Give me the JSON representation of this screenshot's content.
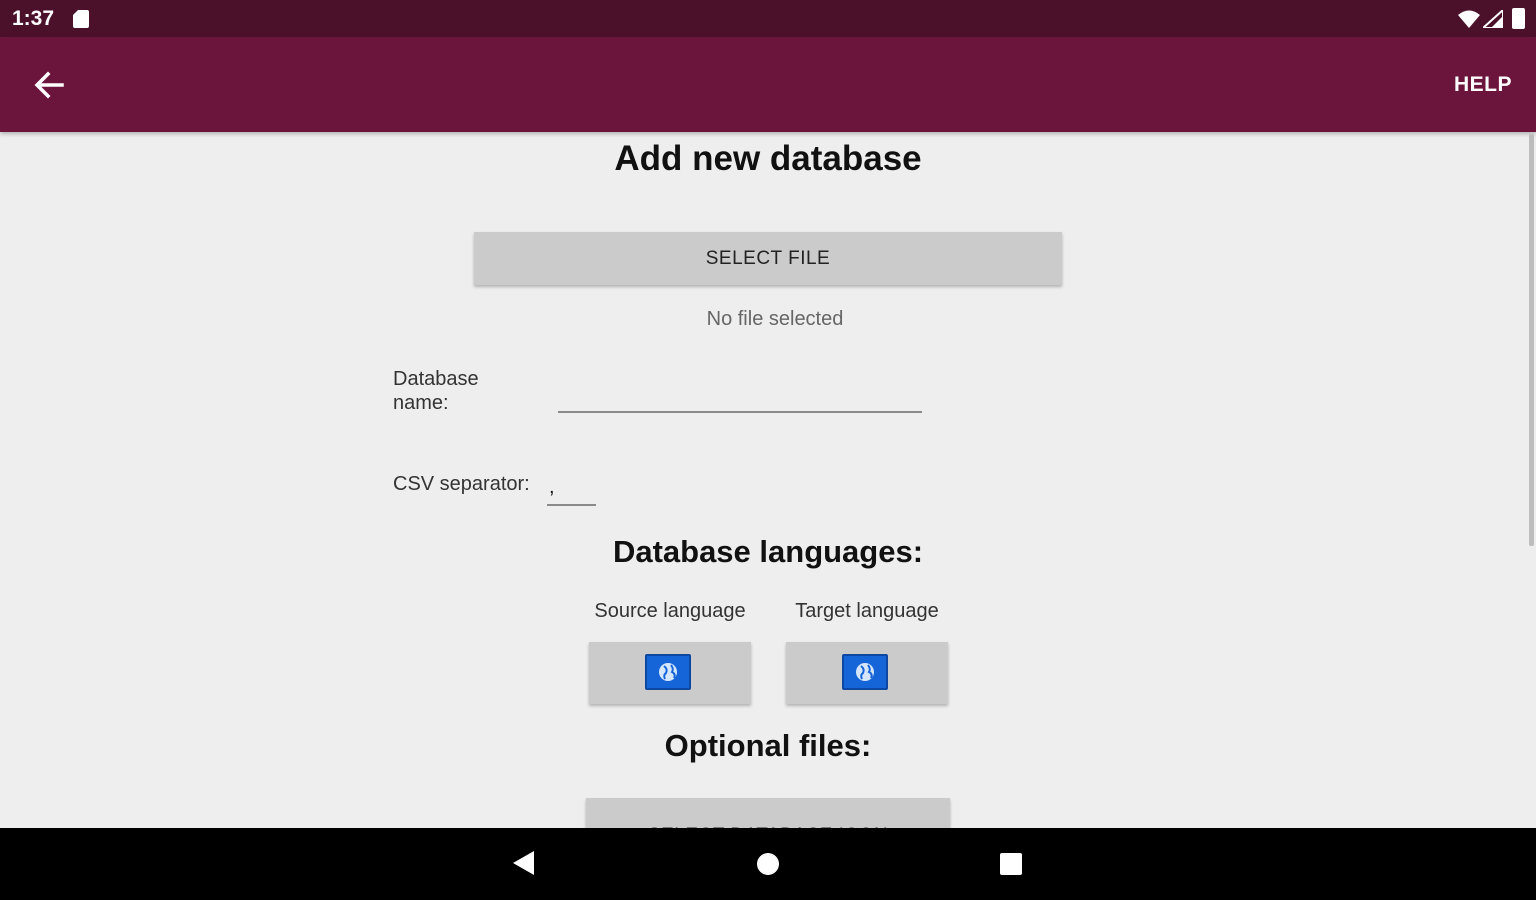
{
  "status_bar": {
    "time": "1:37"
  },
  "app_bar": {
    "help_label": "HELP",
    "color": "#6b143c",
    "status_color": "#4b112b"
  },
  "page": {
    "title": "Add new database",
    "select_file_label": "SELECT FILE",
    "file_status": "No file selected",
    "database_name_label": "Database name:",
    "database_name_value": "",
    "csv_separator_label": "CSV separator:",
    "csv_separator_value": ",",
    "languages_title": "Database languages:",
    "source_language_label": "Source language",
    "target_language_label": "Target language",
    "optional_title": "Optional files:",
    "select_icon_label": "SELECT DATABASE ICON"
  },
  "icons": {
    "back": "arrow-left-icon",
    "sd_card": "sd-card-icon",
    "wifi": "wifi-icon",
    "signal": "signal-icon",
    "battery": "battery-icon",
    "globe": "globe-icon",
    "nav_back": "triangle-back-icon",
    "nav_home": "circle-home-icon",
    "nav_recents": "square-recents-icon"
  }
}
